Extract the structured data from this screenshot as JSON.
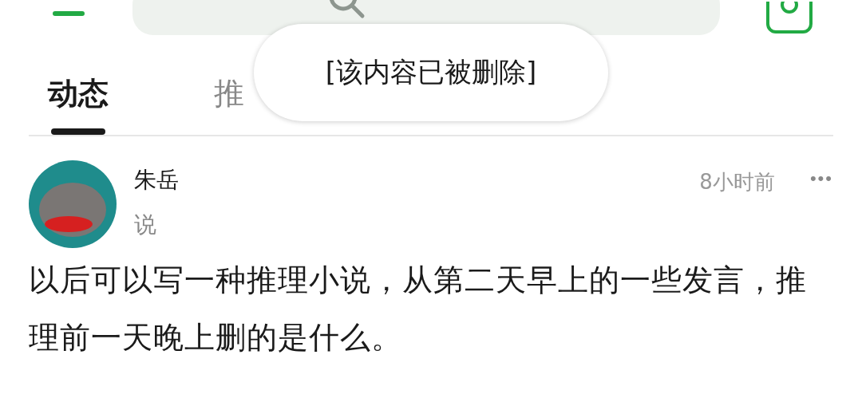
{
  "tabs": [
    {
      "label": "动态",
      "selected": true
    },
    {
      "label": "推",
      "selected": false
    }
  ],
  "toast": {
    "text": "[该内容已被删除]"
  },
  "post": {
    "author": "朱岳",
    "action": "说",
    "time": "8小时前",
    "more": "•••",
    "body": "以后可以写一种推理小说，从第二天早上的一些发言，推理前一天晚上删的是什么。"
  }
}
